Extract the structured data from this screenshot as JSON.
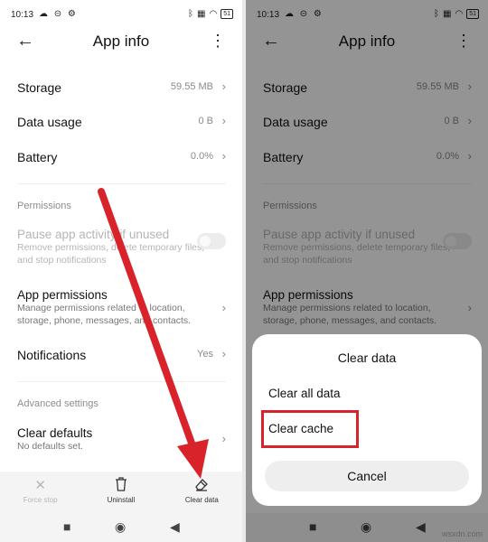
{
  "status": {
    "time": "10:13",
    "left_icons": "☁ ⊝ ⚙",
    "battery": "51"
  },
  "appbar": {
    "title": "App info"
  },
  "rows": {
    "storage": {
      "label": "Storage",
      "value": "59.55 MB"
    },
    "data_usage": {
      "label": "Data usage",
      "value": "0 B"
    },
    "battery": {
      "label": "Battery",
      "value": "0.0%"
    }
  },
  "permissions": {
    "section": "Permissions",
    "pause_title": "Pause app activity if unused",
    "pause_sub": "Remove permissions, delete temporary files, and stop notifications",
    "app_perm_title": "App permissions",
    "app_perm_sub": "Manage permissions related to location, storage, phone, messages, and contacts."
  },
  "notifications": {
    "label": "Notifications",
    "value": "Yes"
  },
  "advanced": {
    "section": "Advanced settings",
    "clear_defaults": "Clear defaults",
    "clear_defaults_sub": "No defaults set."
  },
  "actions": {
    "force_stop": "Force stop",
    "uninstall": "Uninstall",
    "clear_data": "Clear data"
  },
  "dialog": {
    "title": "Clear data",
    "clear_all": "Clear all data",
    "clear_cache": "Clear cache",
    "cancel": "Cancel"
  },
  "watermark": "wsxdn.com",
  "colors": {
    "annotation_red": "#d8232a"
  }
}
